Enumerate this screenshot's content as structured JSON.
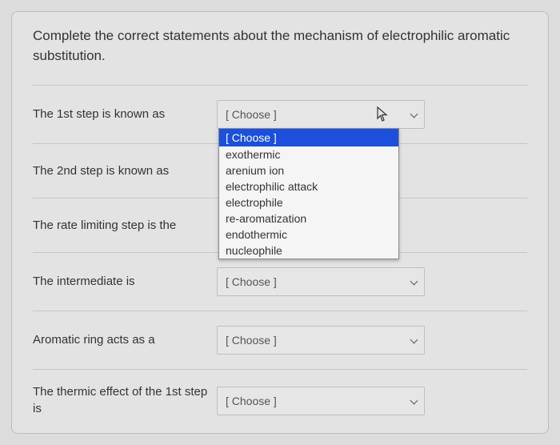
{
  "question": "Complete the correct statements about the mechanism of electrophilic aromatic substitution.",
  "placeholder": "[ Choose ]",
  "rows": [
    {
      "label": "The 1st step is known as"
    },
    {
      "label": "The 2nd step is known as"
    },
    {
      "label": "The rate limiting step is the"
    },
    {
      "label": "The intermediate is"
    },
    {
      "label": "Aromatic ring acts as a"
    },
    {
      "label": "The thermic effect of the 1st step is"
    }
  ],
  "dropdown": {
    "header": "[ Choose ]",
    "options": [
      "exothermic",
      "arenium ion",
      "electrophilic attack",
      "electrophile",
      "re-aromatization",
      "endothermic",
      "nucleophile"
    ]
  }
}
